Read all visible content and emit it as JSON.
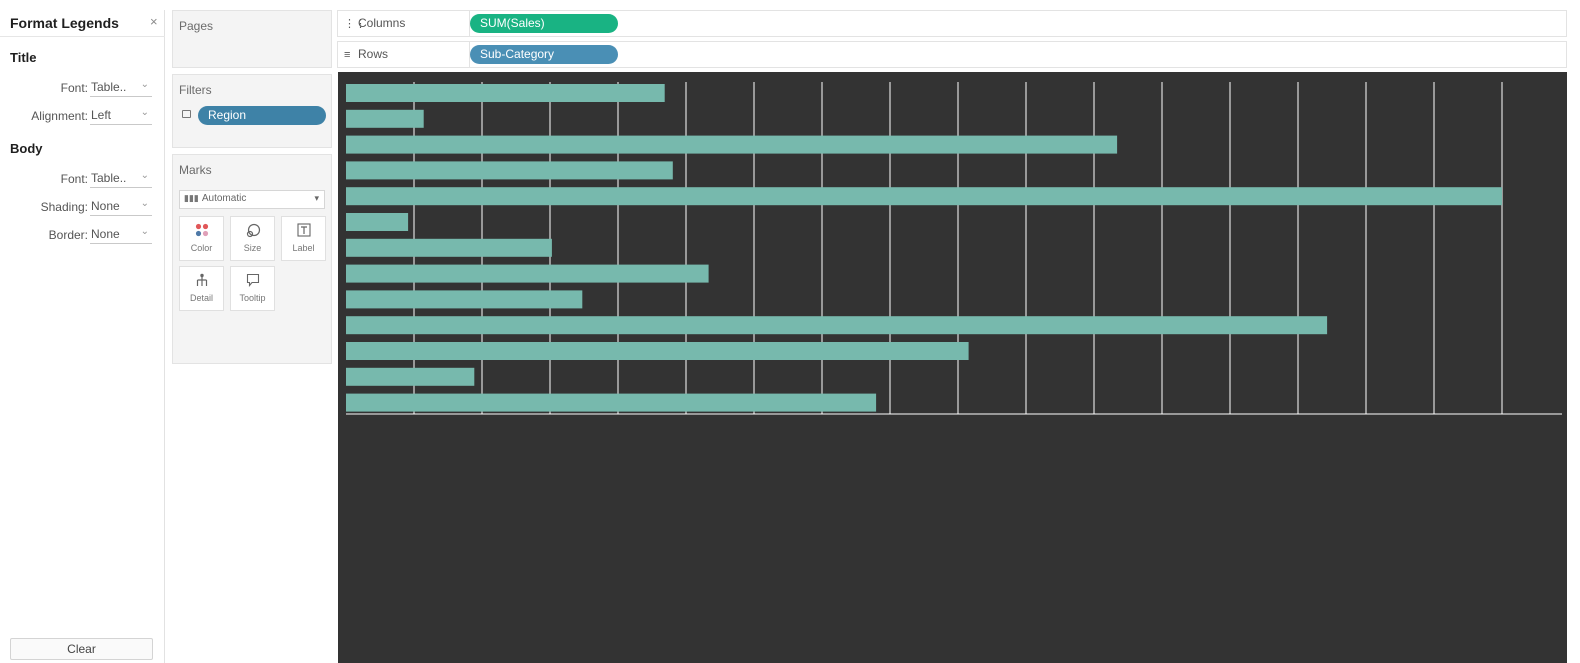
{
  "format_panel": {
    "title": "Format Legends",
    "close_glyph": "×",
    "title_section": "Title",
    "body_section": "Body",
    "rows": [
      {
        "label": "Font:",
        "value": "Table..",
        "section": "title"
      },
      {
        "label": "Alignment:",
        "value": "Left",
        "section": "title"
      },
      {
        "label": "Font:",
        "value": "Table..",
        "section": "body"
      },
      {
        "label": "Shading:",
        "value": "None",
        "section": "body"
      },
      {
        "label": "Border:",
        "value": "None",
        "section": "body"
      }
    ],
    "clear_label": "Clear"
  },
  "pages_card": {
    "title": "Pages"
  },
  "filters_card": {
    "title": "Filters",
    "pill": "Region"
  },
  "marks_card": {
    "title": "Marks",
    "mark_type": "Automatic",
    "buttons": [
      {
        "label": "Color",
        "icon": "color-dots-icon"
      },
      {
        "label": "Size",
        "icon": "size-icon"
      },
      {
        "label": "Label",
        "icon": "label-icon"
      },
      {
        "label": "Detail",
        "icon": "detail-icon"
      },
      {
        "label": "Tooltip",
        "icon": "tooltip-icon"
      }
    ]
  },
  "shelves": {
    "columns_label": "Columns",
    "columns_pill": "SUM(Sales)",
    "rows_label": "Rows",
    "rows_pill": "Sub-Category"
  },
  "colors": {
    "measure_pill": "#19b383",
    "dimension_pill": "#4a8fb5",
    "filter_pill": "#3e82a7",
    "bar": "#77b9ad",
    "viz_background": "#333333",
    "gridline": "#ffffff"
  },
  "chart_data": {
    "type": "bar",
    "orientation": "horizontal",
    "categories": [],
    "values": [
      472,
      115,
      1142,
      484,
      1712,
      92,
      305,
      537,
      350,
      1453,
      922,
      190,
      785
    ],
    "gridlines": 17,
    "grid": true
  }
}
